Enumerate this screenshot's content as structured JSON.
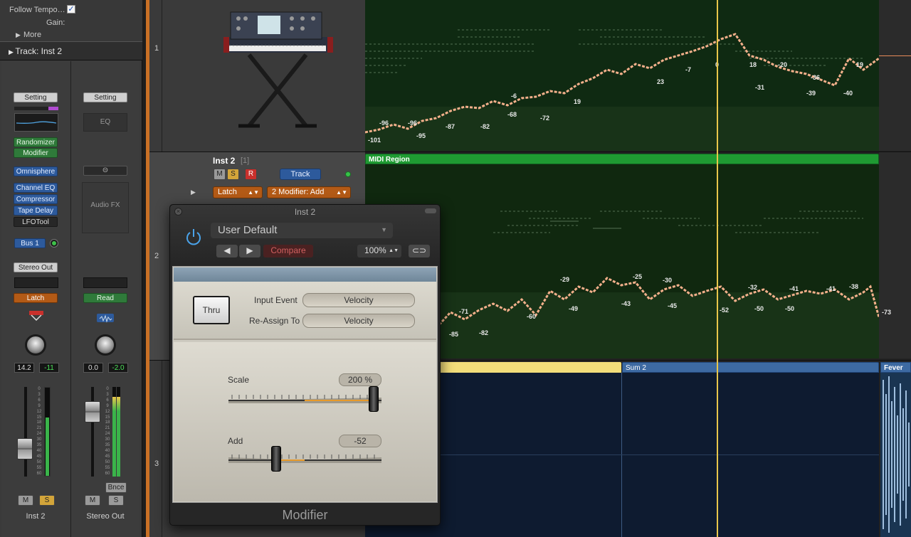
{
  "inspector": {
    "follow_tempo_label": "Follow Tempo…",
    "gain_label": "Gain:",
    "more_label": "More",
    "track_label": "Track:",
    "track_name": "Inst 2"
  },
  "strips": [
    {
      "setting": "Setting",
      "midi_fx": [
        "Randomizer",
        "Modifier"
      ],
      "instrument": "Omnisphere",
      "audio_fx": [
        "Channel EQ",
        "Compressor",
        "Tape Delay",
        "LFOTool"
      ],
      "send": "Bus 1",
      "output": "Stereo Out",
      "automation": "Latch",
      "volume": "14.2",
      "peak": "-11",
      "mute": "M",
      "solo": "S",
      "name": "Inst 2"
    },
    {
      "setting": "Setting",
      "eq": "EQ",
      "audio_fx": "Audio FX",
      "automation": "Read",
      "volume": "0.0",
      "peak": "-2.0",
      "bounce": "Bnce",
      "mute": "M",
      "solo": "S",
      "name": "Stereo Out"
    }
  ],
  "meter_scale": [
    "0",
    "3",
    "6",
    "9",
    "12",
    "15",
    "18",
    "21",
    "24",
    "30",
    "35",
    "40",
    "45",
    "50",
    "55",
    "60"
  ],
  "tracks": [
    {
      "number": "1"
    },
    {
      "number": "2",
      "name": "Inst 2",
      "index": "[1]",
      "m": "M",
      "s": "S",
      "r": "R",
      "track_button": "Track",
      "automation_mode": "Latch",
      "automation_param": "2 Modifier: Add"
    },
    {
      "number": "3"
    }
  ],
  "regions": {
    "midi_region": "MIDI Region",
    "sum2": "Sum 2",
    "fever": "Fever Pi"
  },
  "lane1_labels": [
    "-96",
    "-101",
    "-96",
    "-95",
    "-87",
    "-82",
    "-68",
    "-72",
    "-6",
    "19",
    "23",
    "-7",
    "0",
    "18",
    "-20",
    "-31",
    "-36",
    "-39",
    "-40",
    "19"
  ],
  "lane2_labels": [
    "-71",
    "-85",
    "-82",
    "-60",
    "-49",
    "-29",
    "-25",
    "-43",
    "-30",
    "-45",
    "-52",
    "-32",
    "-50",
    "-50",
    "-41",
    "-41",
    "-38",
    "-73"
  ],
  "plugin": {
    "title": "Inst 2",
    "preset": "User Default",
    "compare": "Compare",
    "zoom": "100%",
    "thru": "Thru",
    "input_event_label": "Input Event",
    "input_event_value": "Velocity",
    "reassign_label": "Re-Assign To",
    "reassign_value": "Velocity",
    "scale_label": "Scale",
    "scale_value": "200 %",
    "scale_level": 0.98,
    "add_label": "Add",
    "add_value": "-52",
    "add_level": 0.3,
    "footer": "Modifier"
  }
}
